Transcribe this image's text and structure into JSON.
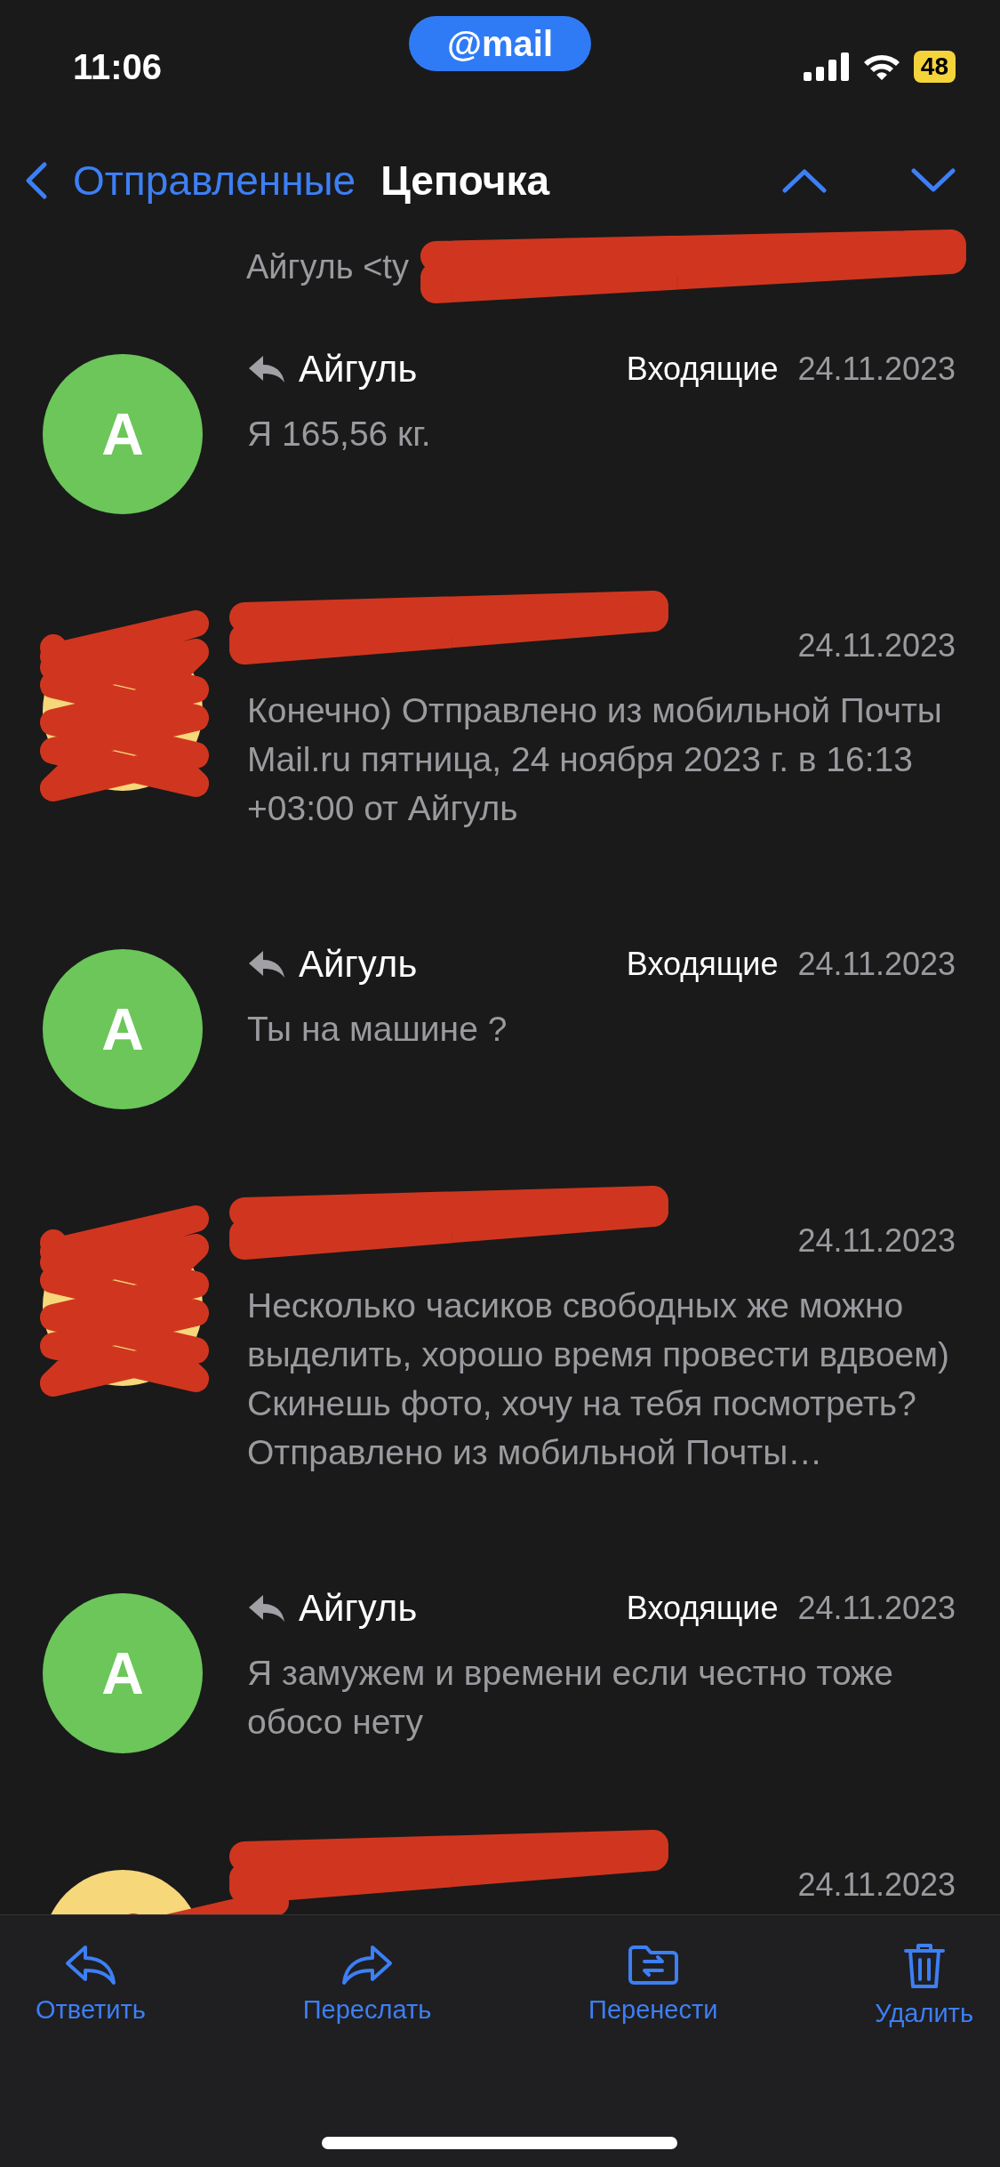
{
  "status_bar": {
    "time": "11:06",
    "app_badge": "@mail",
    "battery": "48"
  },
  "header": {
    "back_label": "Отправленные",
    "title": "Цепочка"
  },
  "top_fragment": "Айгуль <ty",
  "messages": [
    {
      "kind": "named",
      "avatar_letter": "А",
      "color": "#6cc65a",
      "sender": "Айгуль",
      "folder": "Входящие",
      "date": "24.11.2023",
      "body": "Я 165,56 кг."
    },
    {
      "kind": "hidden",
      "color": "#f6d77a",
      "date": "24.11.2023",
      "body": "Конечно) Отправлено из мобильной Почты Mail.ru пятница, 24 ноября 2023 г. в 16:13 +03:00 от Айгуль"
    },
    {
      "kind": "named",
      "avatar_letter": "А",
      "color": "#6cc65a",
      "sender": "Айгуль",
      "folder": "Входящие",
      "date": "24.11.2023",
      "body": "Ты на машине ?"
    },
    {
      "kind": "hidden",
      "color": "#f6d77a",
      "date": "24.11.2023",
      "body": "Несколько часиков свободных же можно выделить, хорошо время провести вдвоем) Скинешь фото, хочу на тебя посмотреть? Отправлено из мобильной Почты…"
    },
    {
      "kind": "named",
      "avatar_letter": "А",
      "color": "#6cc65a",
      "sender": "Айгуль",
      "folder": "Входящие",
      "date": "24.11.2023",
      "body": "Я замужем и времени если честно тоже обосо нету"
    },
    {
      "kind": "hidden",
      "color": "#f6d77a",
      "date": "24.11.2023"
    }
  ],
  "toolbar": [
    {
      "kind": "reply",
      "label": "Ответить"
    },
    {
      "kind": "forward",
      "label": "Переслать"
    },
    {
      "kind": "move",
      "label": "Перенести"
    },
    {
      "kind": "delete",
      "label": "Удалить"
    }
  ]
}
